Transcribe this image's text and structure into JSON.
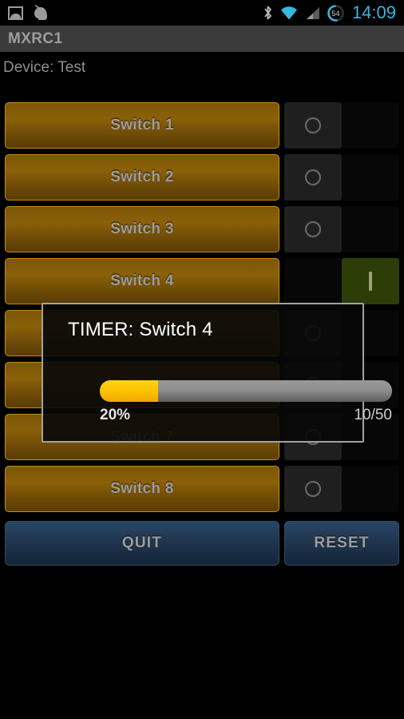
{
  "statusbar": {
    "left_icons": [
      {
        "name": "photo-icon",
        "label": "photo"
      },
      {
        "name": "voice-search-icon",
        "label": "voice search"
      }
    ],
    "right_icons": [
      {
        "name": "bluetooth-icon",
        "label": "bluetooth"
      },
      {
        "name": "wifi-icon",
        "label": "wifi"
      },
      {
        "name": "cell-signal-icon",
        "label": "cell signal"
      }
    ],
    "battery_level": "54",
    "clock": "14:09",
    "accent_color": "#3AB7E0"
  },
  "titlebar": {
    "title": "MXRC1",
    "background_color": "#3B3B3B"
  },
  "device": {
    "label": "Device: Test"
  },
  "switches": {
    "off_glyph": "O",
    "on_glyph": "I",
    "items": [
      {
        "label": "Switch 1",
        "state": "off"
      },
      {
        "label": "Switch 2",
        "state": "off"
      },
      {
        "label": "Switch 3",
        "state": "off"
      },
      {
        "label": "Switch 4",
        "state": "on"
      },
      {
        "label": "Switch 5",
        "state": "off"
      },
      {
        "label": "Switch 6",
        "state": "off"
      },
      {
        "label": "Switch 7",
        "state": "off"
      },
      {
        "label": "Switch 8",
        "state": "off"
      }
    ]
  },
  "actions": {
    "quit_label": "QUIT",
    "reset_label": "RESET",
    "button_color": "#20364F"
  },
  "dialog": {
    "title": "TIMER: Switch 4",
    "progress_percent_label": "20%",
    "progress_count_label": "10/50",
    "progress_value": 20,
    "progress_max": 100,
    "fill_color": "#FFC400",
    "track_color": "#8E8E8E"
  }
}
